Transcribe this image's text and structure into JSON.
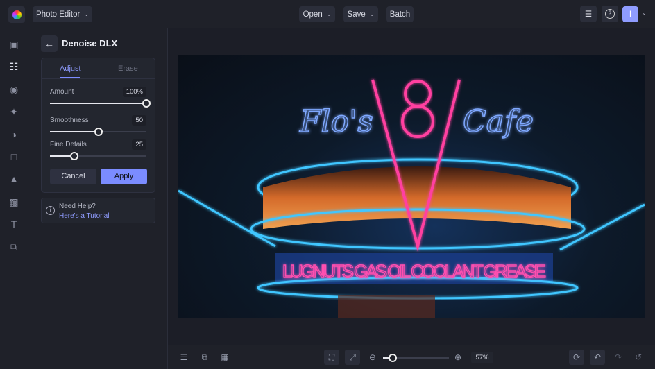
{
  "topbar": {
    "app_menu": "Photo Editor",
    "open": "Open",
    "save": "Save",
    "batch": "Batch",
    "avatar_initial": "I"
  },
  "panel": {
    "title": "Denoise DLX",
    "tabs": [
      "Adjust",
      "Erase"
    ],
    "sliders": [
      {
        "label": "Amount",
        "value_text": "100%",
        "value": 100
      },
      {
        "label": "Smoothness",
        "value_text": "50",
        "value": 50
      },
      {
        "label": "Fine Details",
        "value_text": "25",
        "value": 25
      }
    ],
    "cancel": "Cancel",
    "apply": "Apply",
    "help_title": "Need Help?",
    "help_link": "Here's a Tutorial"
  },
  "photo": {
    "sign_lettering": [
      "Flo's",
      "V8",
      "Cafe",
      "LUGNUTS GAS OIL COOLANT GREASE"
    ]
  },
  "bottom": {
    "zoom_text": "57%",
    "zoom_value": 57
  },
  "colors": {
    "accent": "#7b8cff",
    "bg": "#1c1e27"
  }
}
